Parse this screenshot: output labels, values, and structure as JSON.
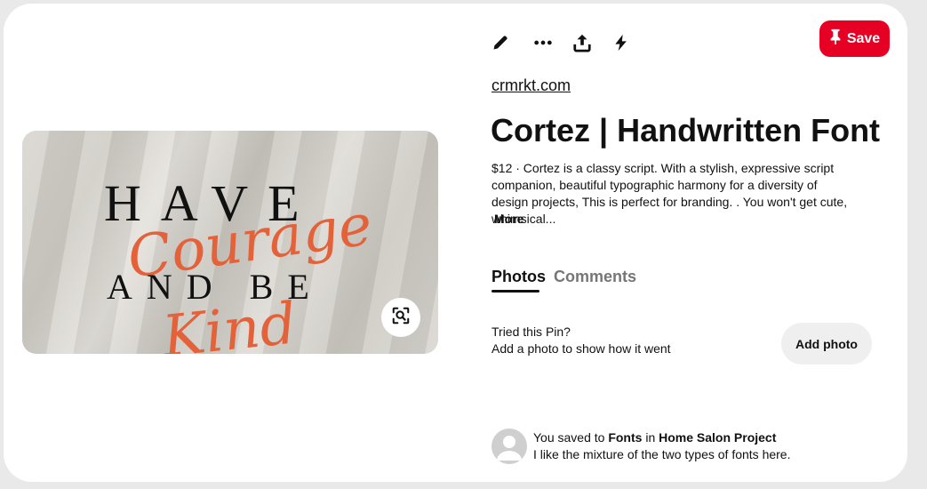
{
  "toolbar": {
    "icons": [
      "edit-icon",
      "more-options-icon",
      "share-icon",
      "quick-actions-icon"
    ],
    "save_label": "Save"
  },
  "pin": {
    "image_text": {
      "line1": "HAVE",
      "line2": "Courage",
      "line3": "AND BE",
      "line4": "Kind"
    },
    "domain": "crmrkt.com",
    "title": "Cortez | Handwritten Font",
    "description": "$12 · Cortez is a classy script. With a stylish, expressive script companion, beautiful typographic harmony for a diversity of design projects, This is perfect for branding. . You won't get cute, whimsical...",
    "more_label": "More"
  },
  "tabs": [
    {
      "label": "Photos",
      "active": true
    },
    {
      "label": "Comments",
      "active": false
    }
  ],
  "tried": {
    "title": "Tried this Pin?",
    "subtitle": "Add a photo to show how it went",
    "button_label": "Add photo"
  },
  "saved": {
    "prefix": "You saved to ",
    "board": "Fonts",
    "middle": " in ",
    "section": "Home Salon Project",
    "note": "I like the mixture of the two types of fonts here."
  },
  "colors": {
    "accent": "#e60023",
    "image_script": "#e3623a",
    "muted_tab": "#767676",
    "button_bg": "#efefef"
  }
}
